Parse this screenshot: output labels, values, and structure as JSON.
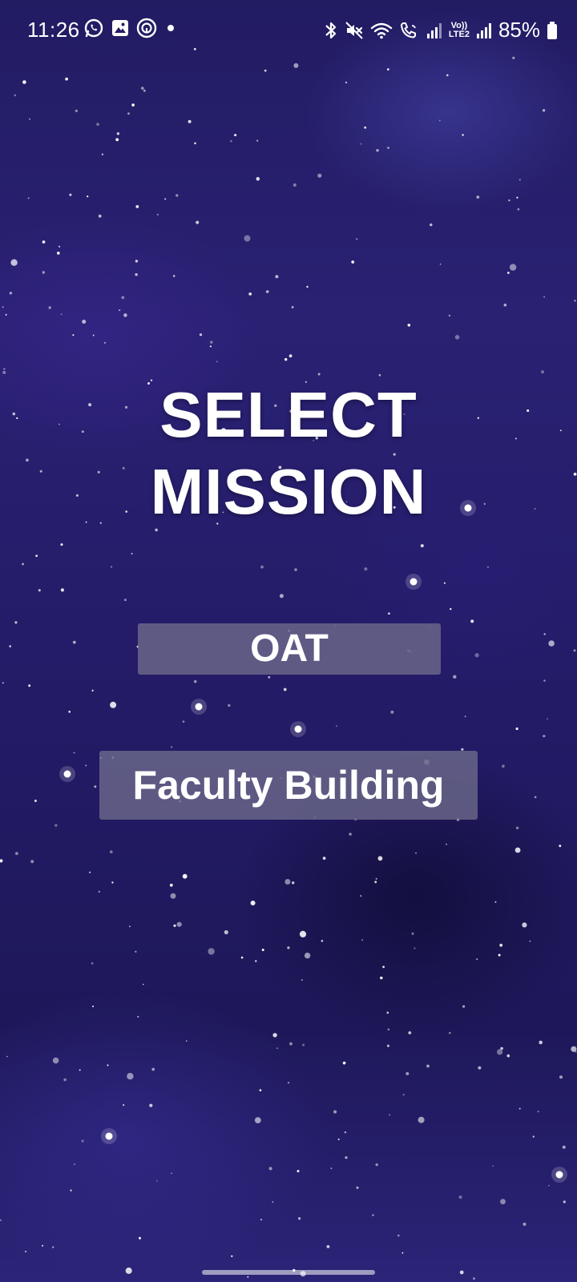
{
  "status_bar": {
    "time": "11:26",
    "battery_percent": "85%",
    "left_icons": [
      "whatsapp-icon",
      "gallery-icon",
      "threads-icon",
      "notification-dot-icon"
    ],
    "right_icons": [
      "bluetooth-icon",
      "mute-icon",
      "wifi-icon",
      "wifi-calling-icon",
      "signal-1-icon",
      "volte-lte2-icon",
      "signal-2-icon",
      "battery-icon"
    ],
    "volte_label_top": "Vo))",
    "volte_label_bottom": "LTE2"
  },
  "screen": {
    "title_line1": "SELECT",
    "title_line2": "MISSION"
  },
  "missions": [
    {
      "label": "OAT"
    },
    {
      "label": "Faculty Building"
    }
  ],
  "colors": {
    "background": "#231b66",
    "button_bg": "#6e6c8c",
    "text": "#ffffff"
  }
}
